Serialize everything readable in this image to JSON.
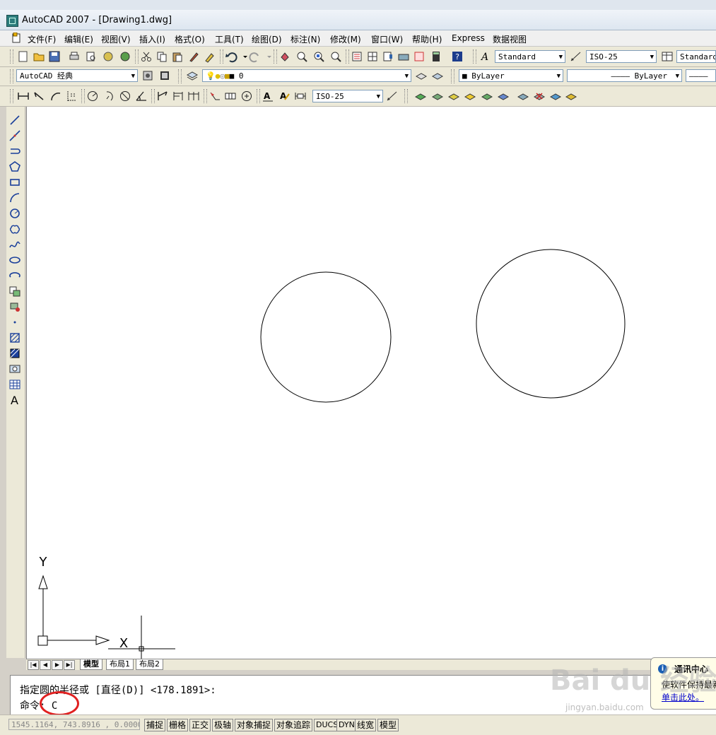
{
  "window": {
    "title": "AutoCAD 2007 - [Drawing1.dwg]"
  },
  "menu": [
    {
      "label": "文件(F)"
    },
    {
      "label": "编辑(E)"
    },
    {
      "label": "视图(V)"
    },
    {
      "label": "插入(I)"
    },
    {
      "label": "格式(O)"
    },
    {
      "label": "工具(T)"
    },
    {
      "label": "绘图(D)"
    },
    {
      "label": "标注(N)"
    },
    {
      "label": "修改(M)"
    },
    {
      "label": "窗口(W)"
    },
    {
      "label": "帮助(H)"
    },
    {
      "label": "Express"
    },
    {
      "label": "数据视图"
    }
  ],
  "toolbar": {
    "text_style": "Standard",
    "dim_style": "ISO-25",
    "table_style": "Standard",
    "workspace": "AutoCAD 经典",
    "layer": "0",
    "color": "ByLayer",
    "linetype": "ByLayer",
    "dim_style2": "ISO-25"
  },
  "ucs": {
    "y_label": "Y",
    "x_label": "X"
  },
  "layout_tabs": [
    {
      "label": "模型"
    },
    {
      "label": "布局1"
    },
    {
      "label": "布局2"
    }
  ],
  "command": {
    "prompt_line": "指定圆的半径或 [直径(D)] <178.1891>:",
    "current_line": "命令: C"
  },
  "status": {
    "coordinates": "1545.1164, 743.8916 , 0.0000",
    "buttons": [
      {
        "label": "捕捉"
      },
      {
        "label": "栅格"
      },
      {
        "label": "正交"
      },
      {
        "label": "极轴"
      },
      {
        "label": "对象捕捉"
      },
      {
        "label": "对象追踪"
      },
      {
        "label": "DUCS"
      },
      {
        "label": "DYN"
      },
      {
        "label": "线宽"
      },
      {
        "label": "模型"
      }
    ]
  },
  "notification": {
    "title": "通讯中心",
    "body": "使软件保持最新",
    "link": "单击此处。"
  },
  "watermark": {
    "main": "Bai du 经验",
    "sub": "jingyan.baidu.com"
  },
  "colors": {
    "canvas": "#ffffff",
    "highlight": "#e02020"
  }
}
